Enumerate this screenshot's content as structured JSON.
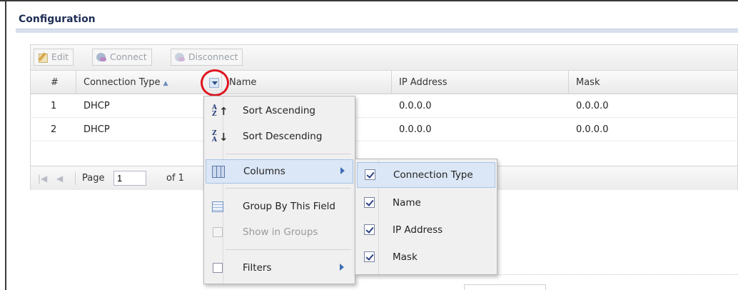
{
  "section": {
    "title": "Configuration"
  },
  "toolbar": {
    "edit_label": "Edit",
    "connect_label": "Connect",
    "disconnect_label": "Disconnect"
  },
  "grid": {
    "columns": [
      "#",
      "Connection Type",
      "Name",
      "IP Address",
      "Mask"
    ],
    "sorted_column": "Connection Type",
    "sort_direction": "ascending",
    "rows": [
      {
        "num": "1",
        "type": "DHCP",
        "ip": "0.0.0.0",
        "mask": "0.0.0.0"
      },
      {
        "num": "2",
        "type": "DHCP",
        "ip": "0.0.0.0",
        "mask": "0.0.0.0"
      }
    ]
  },
  "pager": {
    "page_label": "Page",
    "page_value": "1",
    "of_label": "of 1"
  },
  "menu": {
    "sort_asc": "Sort Ascending",
    "sort_desc": "Sort Descending",
    "columns": "Columns",
    "group_by": "Group By This Field",
    "show_in_groups": "Show in Groups",
    "filters": "Filters"
  },
  "submenu": {
    "items": [
      {
        "label": "Connection Type",
        "checked": true
      },
      {
        "label": "Name",
        "checked": true
      },
      {
        "label": "IP Address",
        "checked": true
      },
      {
        "label": "Mask",
        "checked": true
      }
    ]
  },
  "colors": {
    "accent_red": "#e0141e",
    "menu_highlight": "#dbe7f6",
    "title": "#1f2f55"
  },
  "icons": [
    "edit-icon",
    "connect-icon",
    "disconnect-icon",
    "sort-ascending-icon",
    "sort-descending-icon",
    "columns-icon",
    "group-icon",
    "checkbox-icon",
    "submenu-arrow-icon",
    "first-page-icon",
    "prev-page-icon"
  ]
}
